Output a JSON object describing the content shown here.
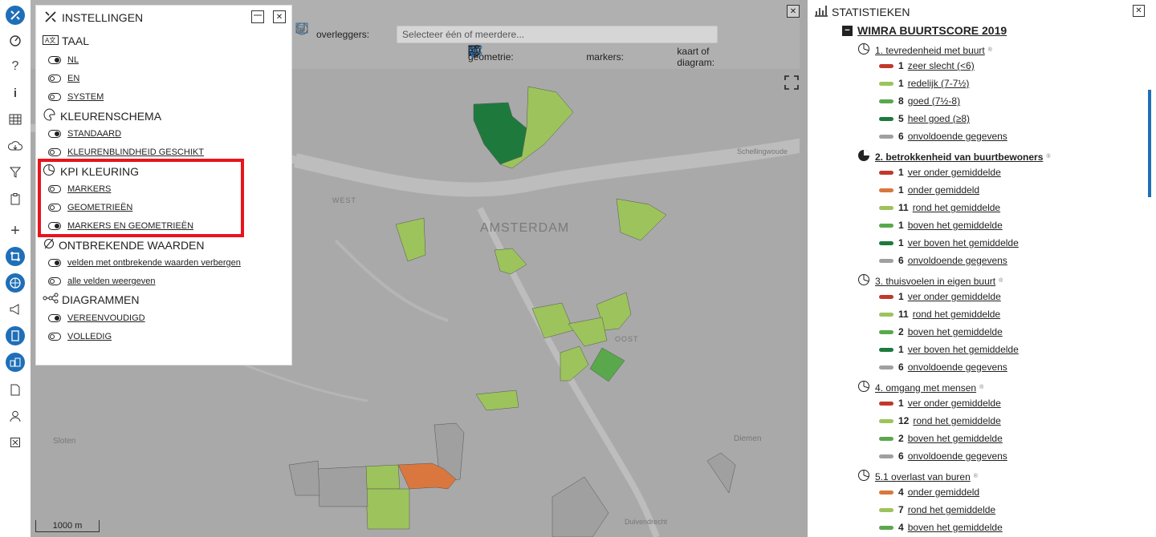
{
  "settings": {
    "title": "INSTELLINGEN",
    "sections": [
      {
        "title": "TAAL",
        "icon": "language-icon",
        "options": [
          {
            "label": "NL",
            "on": true
          },
          {
            "label": "EN",
            "on": false
          },
          {
            "label": "SYSTEM",
            "on": false
          }
        ]
      },
      {
        "title": "KLEURENSCHEMA",
        "icon": "palette-icon",
        "options": [
          {
            "label": "STANDAARD",
            "on": true
          },
          {
            "label": "KLEURENBLINDHEID GESCHIKT",
            "on": false
          }
        ]
      },
      {
        "title": "KPI KLEURING",
        "icon": "pie-chart-icon",
        "options": [
          {
            "label": "MARKERS",
            "on": false
          },
          {
            "label": "GEOMETRIEËN",
            "on": false
          },
          {
            "label": "MARKERS EN GEOMETRIEËN",
            "on": true
          }
        ]
      },
      {
        "title": "ONTBREKENDE WAARDEN",
        "icon": "empty-set-icon",
        "options": [
          {
            "label": "velden met ontbrekende waarden verbergen",
            "on": true
          },
          {
            "label": "alle velden weergeven",
            "on": false
          }
        ]
      },
      {
        "title": "DIAGRAMMEN",
        "icon": "network-icon",
        "options": [
          {
            "label": "VEREENVOUDIGD",
            "on": true
          },
          {
            "label": "VOLLEDIG",
            "on": false
          }
        ]
      }
    ]
  },
  "map": {
    "overlays_label": "overleggers:",
    "overlays_placeholder": "Selecteer één of meerdere...",
    "geometry_label": "geometrie:",
    "markers_label": "markers:",
    "map_or_diagram_label": "kaart of diagram:",
    "scale": "1000 m",
    "place_labels": [
      "AMSTERDAM",
      "WEST",
      "OOST",
      "Schellingwoude",
      "Sloten",
      "Diemen",
      "Duivendrecht"
    ]
  },
  "stats": {
    "title": "STATISTIEKEN",
    "group_title": "WIMRA BUURTSCORE 2019",
    "kpis": [
      {
        "title": "1. tevredenheid met buurt",
        "bold": false,
        "rows": [
          {
            "color": "#c0392b",
            "n": "1",
            "label": "zeer slecht (<6)"
          },
          {
            "color": "#9dc35c",
            "n": "1",
            "label": "redelijk (7-7½)"
          },
          {
            "color": "#5aa84c",
            "n": "8",
            "label": "goed (7½-8)"
          },
          {
            "color": "#1e7a3c",
            "n": "5",
            "label": "heel goed (≥8)"
          },
          {
            "color": "#a0a0a0",
            "n": "6",
            "label": "onvoldoende gegevens"
          }
        ]
      },
      {
        "title": "2. betrokkenheid van buurtbewoners",
        "bold": true,
        "rows": [
          {
            "color": "#c0392b",
            "n": "1",
            "label": "ver onder gemiddelde"
          },
          {
            "color": "#d9773f",
            "n": "1",
            "label": "onder gemiddeld"
          },
          {
            "color": "#9dc35c",
            "n": "11",
            "label": "rond het gemiddelde"
          },
          {
            "color": "#5aa84c",
            "n": "1",
            "label": "boven het gemiddelde"
          },
          {
            "color": "#1e7a3c",
            "n": "1",
            "label": "ver boven het gemiddelde"
          },
          {
            "color": "#a0a0a0",
            "n": "6",
            "label": "onvoldoende gegevens"
          }
        ]
      },
      {
        "title": "3. thuisvoelen in eigen buurt",
        "bold": false,
        "rows": [
          {
            "color": "#c0392b",
            "n": "1",
            "label": "ver onder gemiddelde"
          },
          {
            "color": "#9dc35c",
            "n": "11",
            "label": "rond het gemiddelde"
          },
          {
            "color": "#5aa84c",
            "n": "2",
            "label": "boven het gemiddelde"
          },
          {
            "color": "#1e7a3c",
            "n": "1",
            "label": "ver boven het gemiddelde"
          },
          {
            "color": "#a0a0a0",
            "n": "6",
            "label": "onvoldoende gegevens"
          }
        ]
      },
      {
        "title": "4. omgang met mensen",
        "bold": false,
        "rows": [
          {
            "color": "#c0392b",
            "n": "1",
            "label": "ver onder gemiddelde"
          },
          {
            "color": "#9dc35c",
            "n": "12",
            "label": "rond het gemiddelde"
          },
          {
            "color": "#5aa84c",
            "n": "2",
            "label": "boven het gemiddelde"
          },
          {
            "color": "#a0a0a0",
            "n": "6",
            "label": "onvoldoende gegevens"
          }
        ]
      },
      {
        "title": "5.1 overlast van buren",
        "bold": false,
        "rows": [
          {
            "color": "#d9773f",
            "n": "4",
            "label": "onder gemiddeld"
          },
          {
            "color": "#9dc35c",
            "n": "7",
            "label": "rond het gemiddelde"
          },
          {
            "color": "#5aa84c",
            "n": "4",
            "label": "boven het gemiddelde"
          }
        ]
      }
    ]
  }
}
